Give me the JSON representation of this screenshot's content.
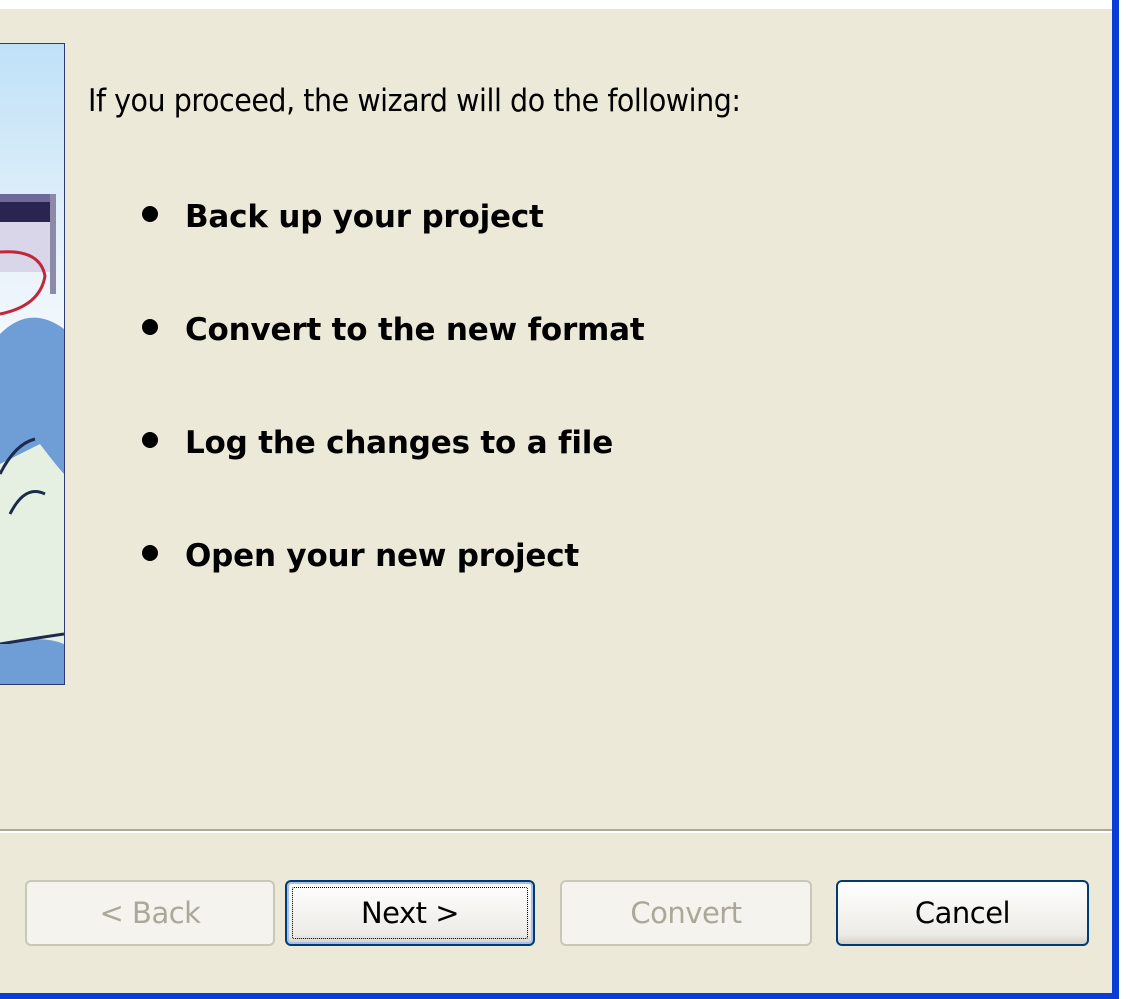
{
  "intro_text": "If you proceed, the wizard will do the following:",
  "steps": [
    {
      "label": "Back up your project"
    },
    {
      "label": "Convert to the new format"
    },
    {
      "label": "Log the changes to a file"
    },
    {
      "label": "Open your new project"
    }
  ],
  "buttons": {
    "back": {
      "label": "< Back",
      "enabled": false
    },
    "next": {
      "label": "Next >",
      "enabled": true,
      "default": true
    },
    "convert": {
      "label": "Convert",
      "enabled": false
    },
    "cancel": {
      "label": "Cancel",
      "enabled": true
    }
  },
  "colors": {
    "dialog_background": "#ECE9D8",
    "window_frame": "#0A3DD8",
    "button_border": "#003C74",
    "disabled_text": "#ACA899"
  }
}
